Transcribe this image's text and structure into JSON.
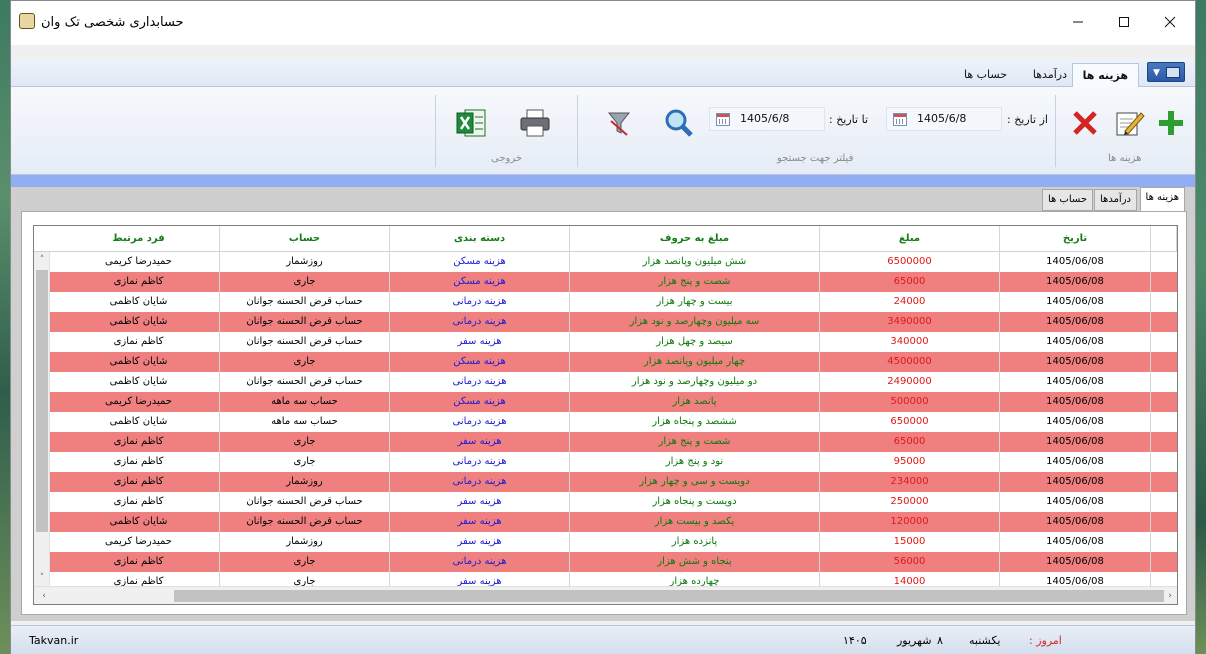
{
  "window": {
    "title": "حسابداری شخصی تک وان"
  },
  "ribbon": {
    "tabs": [
      "هزینه ها",
      "درآمدها",
      "حساب ها"
    ],
    "active_tab": "هزینه ها",
    "groups": {
      "expenses_label": "هزینه ها",
      "filter_label": "فیلتر جهت جستجو",
      "output_label": "خروجی"
    },
    "from_date_label": "از تاریخ :",
    "from_date_value": "1405/6/8",
    "to_date_label": "تا تاریخ :",
    "to_date_value": "1405/6/8"
  },
  "inner_tabs": [
    "هزینه ها",
    "درآمدها",
    "حساب ها"
  ],
  "grid": {
    "columns": {
      "date": "تاریخ",
      "amount": "مبلغ",
      "amount_words": "مبلغ به حروف",
      "category": "دسته بندی",
      "account": "حساب",
      "person": "فرد مرتبط"
    },
    "rows": [
      {
        "date": "1405/06/08",
        "amount": "6500000",
        "words": "شش میلیون وپانصد هزار",
        "category": "هزینه مسکن",
        "account": "روزشمار",
        "person": "حمیدرضا کریمی"
      },
      {
        "date": "1405/06/08",
        "amount": "65000",
        "words": "شصت و پنج هزار",
        "category": "هزینه مسکن",
        "account": "جاری",
        "person": "کاظم نمازی"
      },
      {
        "date": "1405/06/08",
        "amount": "24000",
        "words": "بیست و چهار هزار",
        "category": "هزینه درمانی",
        "account": "حساب قرض الحسنه جوانان",
        "person": "شایان کاظمی"
      },
      {
        "date": "1405/06/08",
        "amount": "3490000",
        "words": "سه میلیون وچهارصد و نود هزار",
        "category": "هزینه درمانی",
        "account": "حساب قرض الحسنه جوانان",
        "person": "شایان کاظمی"
      },
      {
        "date": "1405/06/08",
        "amount": "340000",
        "words": "سیصد و چهل هزار",
        "category": "هزینه سفر",
        "account": "حساب قرض الحسنه جوانان",
        "person": "کاظم نمازی"
      },
      {
        "date": "1405/06/08",
        "amount": "4500000",
        "words": "چهار میلیون وپانصد هزار",
        "category": "هزینه مسکن",
        "account": "جاری",
        "person": "شایان کاظمی"
      },
      {
        "date": "1405/06/08",
        "amount": "2490000",
        "words": "دو میلیون وچهارصد و نود هزار",
        "category": "هزینه درمانی",
        "account": "حساب قرض الحسنه جوانان",
        "person": "شایان کاظمی"
      },
      {
        "date": "1405/06/08",
        "amount": "500000",
        "words": "پانصد هزار",
        "category": "هزینه مسکن",
        "account": "حساب سه ماهه",
        "person": "حمیدرضا کریمی"
      },
      {
        "date": "1405/06/08",
        "amount": "650000",
        "words": "ششصد و پنجاه هزار",
        "category": "هزینه درمانی",
        "account": "حساب سه ماهه",
        "person": "شایان کاظمی"
      },
      {
        "date": "1405/06/08",
        "amount": "65000",
        "words": "شصت و پنج هزار",
        "category": "هزینه سفر",
        "account": "جاری",
        "person": "کاظم نمازی"
      },
      {
        "date": "1405/06/08",
        "amount": "95000",
        "words": "نود و پنج هزار",
        "category": "هزینه درمانی",
        "account": "جاری",
        "person": "کاظم نمازی"
      },
      {
        "date": "1405/06/08",
        "amount": "234000",
        "words": "دویست و سی و چهار هزار",
        "category": "هزینه درمانی",
        "account": "روزشمار",
        "person": "کاظم نمازی"
      },
      {
        "date": "1405/06/08",
        "amount": "250000",
        "words": "دویست و پنجاه هزار",
        "category": "هزینه سفر",
        "account": "حساب قرض الحسنه جوانان",
        "person": "کاظم نمازی"
      },
      {
        "date": "1405/06/08",
        "amount": "120000",
        "words": "یکصد و بیست هزار",
        "category": "هزینه سفر",
        "account": "حساب قرض الحسنه جوانان",
        "person": "شایان کاظمی"
      },
      {
        "date": "1405/06/08",
        "amount": "15000",
        "words": "پانزده هزار",
        "category": "هزینه سفر",
        "account": "روزشمار",
        "person": "حمیدرضا کریمی"
      },
      {
        "date": "1405/06/08",
        "amount": "56000",
        "words": "پنجاه و شش هزار",
        "category": "هزینه درمانی",
        "account": "جاری",
        "person": "کاظم نمازی"
      },
      {
        "date": "1405/06/08",
        "amount": "14000",
        "words": "چهارده هزار",
        "category": "هزینه سفر",
        "account": "جاری",
        "person": "کاظم نمازی"
      }
    ]
  },
  "status": {
    "site": "Takvan.ir",
    "year": "۱۴۰۵",
    "month": "شهریور",
    "day_num": "۸",
    "weekday": "یکشنبه",
    "today_label": "امروز :"
  },
  "colors": {
    "pink_row": "#f08080",
    "header_green": "#177c17",
    "amount_red": "#e01818",
    "category_blue": "#1a1ad6",
    "blue_strip": "#91aef5"
  }
}
